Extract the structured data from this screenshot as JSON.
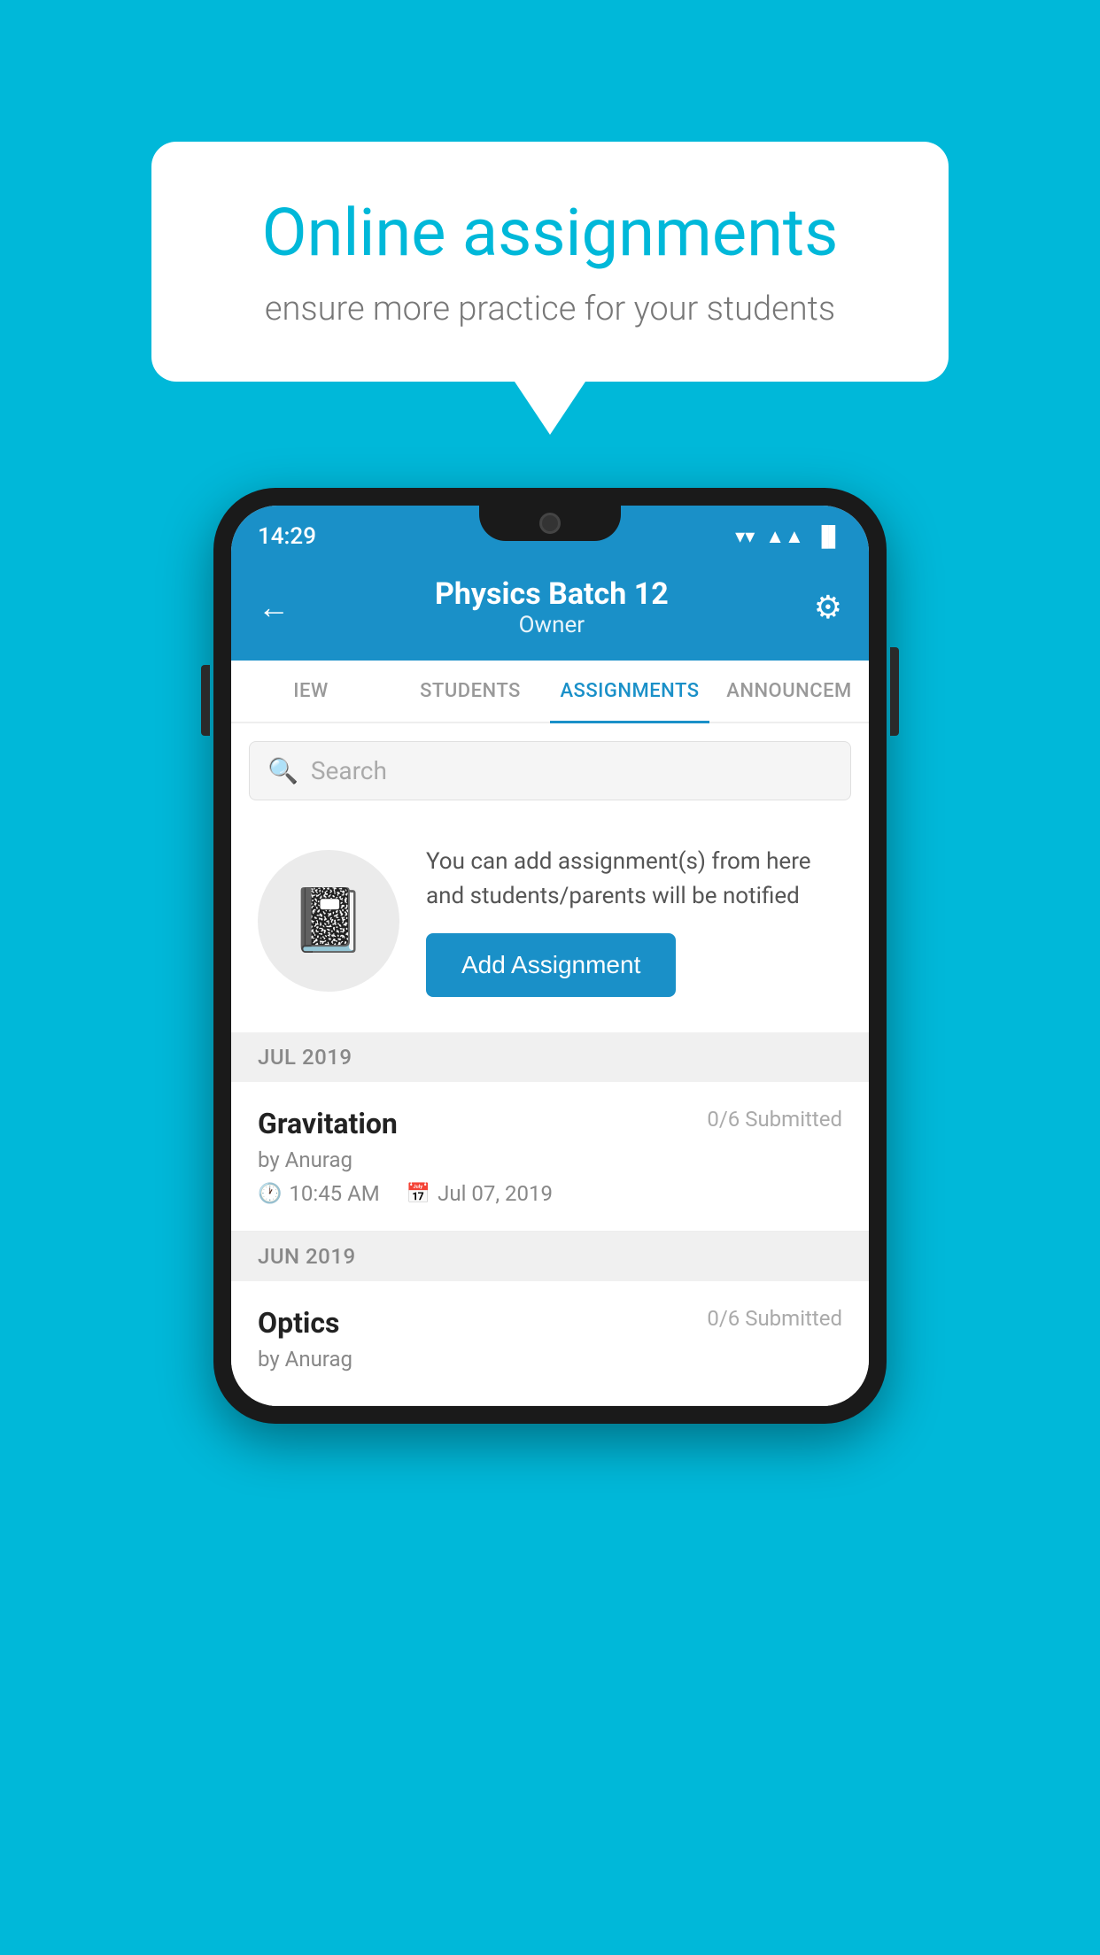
{
  "background_color": "#00b8d9",
  "speech_bubble": {
    "title": "Online assignments",
    "subtitle": "ensure more practice for your students"
  },
  "status_bar": {
    "time": "14:29",
    "wifi_icon": "▼",
    "signal_icon": "▲",
    "battery_icon": "▐"
  },
  "header": {
    "title": "Physics Batch 12",
    "subtitle": "Owner",
    "back_label": "←",
    "settings_label": "⚙"
  },
  "tabs": [
    {
      "label": "IEW",
      "active": false
    },
    {
      "label": "STUDENTS",
      "active": false
    },
    {
      "label": "ASSIGNMENTS",
      "active": true
    },
    {
      "label": "ANNOUNCEM",
      "active": false
    }
  ],
  "search": {
    "placeholder": "Search"
  },
  "promo": {
    "icon": "📓",
    "text": "You can add assignment(s) from here and students/parents will be notified",
    "button_label": "Add Assignment"
  },
  "sections": [
    {
      "label": "JUL 2019",
      "assignments": [
        {
          "title": "Gravitation",
          "submitted": "0/6 Submitted",
          "by": "by Anurag",
          "time": "10:45 AM",
          "date": "Jul 07, 2019"
        }
      ]
    },
    {
      "label": "JUN 2019",
      "assignments": [
        {
          "title": "Optics",
          "submitted": "0/6 Submitted",
          "by": "by Anurag",
          "time": "",
          "date": ""
        }
      ]
    }
  ]
}
